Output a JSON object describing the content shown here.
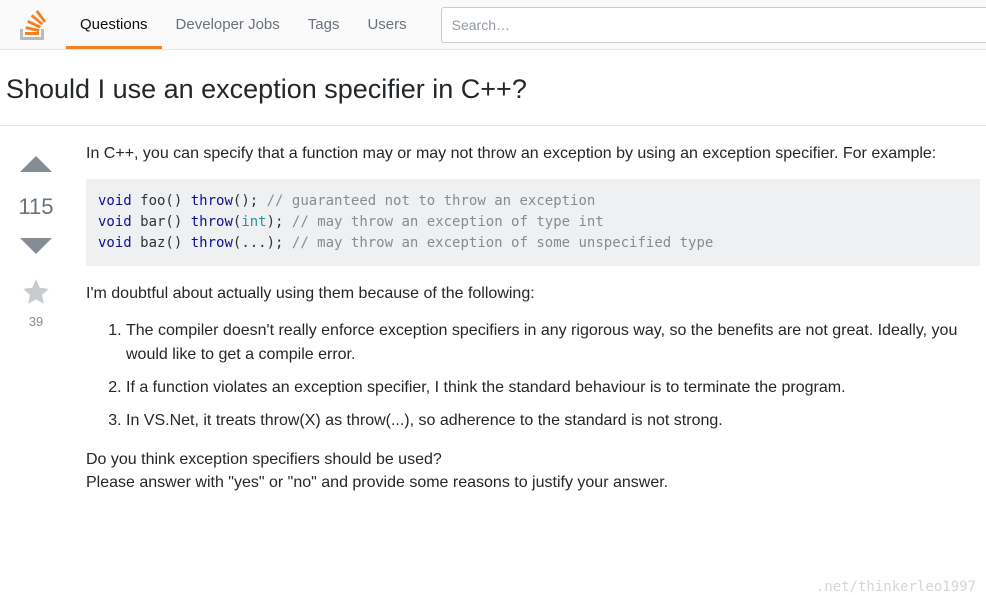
{
  "nav": {
    "items": [
      {
        "label": "Questions",
        "active": true
      },
      {
        "label": "Developer Jobs",
        "active": false
      },
      {
        "label": "Tags",
        "active": false
      },
      {
        "label": "Users",
        "active": false
      }
    ]
  },
  "search": {
    "placeholder": "Search…"
  },
  "question": {
    "title": "Should I use an exception specifier in C++?",
    "score": "115",
    "favorites": "39",
    "intro": "In C++, you can specify that a function may or may not throw an exception by using an exception specifier. For example:",
    "code": {
      "l1_kw1": "void",
      "l1_fn": " foo() ",
      "l1_kw2": "throw",
      "l1_rest": "();",
      "l1_com": " // guaranteed not to throw an exception",
      "l2_kw1": "void",
      "l2_fn": " bar() ",
      "l2_kw2": "throw",
      "l2_paren_o": "(",
      "l2_typ": "int",
      "l2_paren_c": ");",
      "l2_com": " // may throw an exception of type int",
      "l3_kw1": "void",
      "l3_fn": " baz() ",
      "l3_kw2": "throw",
      "l3_rest": "(...);",
      "l3_com": " // may throw an exception of some unspecified type"
    },
    "doubt_line": "I'm doubtful about actually using them because of the following:",
    "reasons": [
      "The compiler doesn't really enforce exception specifiers in any rigorous way, so the benefits are not great. Ideally, you would like to get a compile error.",
      "If a function violates an exception specifier, I think the standard behaviour is to terminate the program.",
      "In VS.Net, it treats throw(X) as throw(...), so adherence to the standard is not strong."
    ],
    "closing1": "Do you think exception specifiers should be used?",
    "closing2": "Please answer with \"yes\" or \"no\" and provide some reasons to justify your answer."
  },
  "watermark": ".net/thinkerleo1997"
}
